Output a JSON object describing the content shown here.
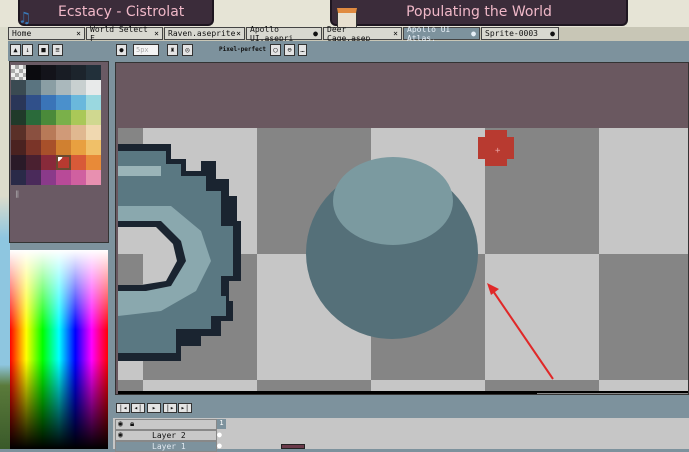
{
  "background_titles": {
    "song": "Ecstacy - Cistrolat",
    "chapter": "Populating the World"
  },
  "tabs": [
    {
      "label": "Home",
      "close": "×"
    },
    {
      "label": "World Select F",
      "close": "×"
    },
    {
      "label": "Raven.aseprite",
      "close": "×"
    },
    {
      "label": "Apollo UI.asepri",
      "close": "●"
    },
    {
      "label": "Deer Cage.asep",
      "close": "×"
    },
    {
      "label": "Apollo UI Atlas.",
      "close": "●",
      "active": true
    },
    {
      "label": "Sprite-0003",
      "close": "●"
    }
  ],
  "toolbar": {
    "brush_size": "5px",
    "pixel_perfect_label": "Pixel-perfect"
  },
  "palette": {
    "colors": [
      "transparent",
      "#0b0b0f",
      "#13131a",
      "#181c24",
      "#1c242c",
      "#22303a",
      "#3a4a52",
      "#5a7480",
      "#8a9ea4",
      "#aab8bc",
      "#c8d0d0",
      "#e8eaea",
      "#2a3658",
      "#30508a",
      "#3a74b8",
      "#4a90cc",
      "#6ab8dc",
      "#9ad8e0",
      "#203a2a",
      "#2a6a3a",
      "#4a8a3a",
      "#7ab04a",
      "#aac858",
      "#d0d890",
      "#5a3028",
      "#8a5040",
      "#b87a58",
      "#d09a78",
      "#e0b890",
      "#f0d8b0",
      "#4a2220",
      "#7a3428",
      "#a8502a",
      "#d08030",
      "#e8a040",
      "#f0c068",
      "#2a1a28",
      "#4a2030",
      "#882a3a",
      "#b83a30",
      "#d85a38",
      "#e88a38",
      "#2a2a48",
      "#4a2a5a",
      "#8a3a8a",
      "#b84a98",
      "#d060a0",
      "#e890b0"
    ],
    "selected_index": 39
  },
  "timeline": {
    "frame_number": "1",
    "layers": [
      "Layer 2",
      "Layer 1"
    ]
  },
  "colors": {
    "accent_red": "#b83a30",
    "annotation_arrow": "#e02828",
    "sphere_dark": "#557079",
    "sphere_light": "#7b9aa0"
  }
}
